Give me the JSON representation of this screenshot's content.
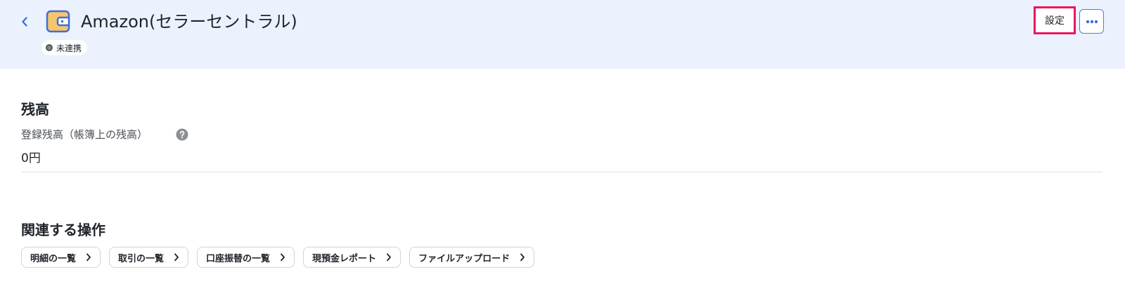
{
  "header": {
    "title": "Amazon(セラーセントラル)",
    "status": "未連携",
    "settings_label": "設定"
  },
  "balance": {
    "section_title": "残高",
    "label": "登録残高（帳簿上の残高）",
    "value": "0円"
  },
  "related": {
    "section_title": "関連する操作",
    "chips": [
      {
        "label": "明細の一覧"
      },
      {
        "label": "取引の一覧"
      },
      {
        "label": "口座振替の一覧"
      },
      {
        "label": "現預金レポート"
      },
      {
        "label": "ファイルアップロード"
      }
    ]
  },
  "icons": {
    "back": "chevron-left-icon",
    "wallet": "wallet-icon",
    "more": "more-horizontal-icon",
    "help": "question-circle-icon",
    "chip_arrow": "chevron-right-icon"
  },
  "colors": {
    "header_bg": "#ebf2fd",
    "accent_blue": "#3f6fd8",
    "highlight": "#e8175c",
    "wallet_fill": "#f6c56d"
  }
}
